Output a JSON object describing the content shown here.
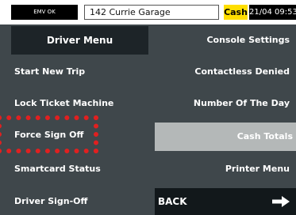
{
  "status_bar": {
    "emv_status": "EMV OK",
    "location": "142 Currie Garage",
    "payment_mode": "Cash",
    "datetime": "21/04 09:53"
  },
  "menu": {
    "title": "Driver Menu",
    "left_items": [
      "Start New Trip",
      "Lock Ticket Machine",
      "Force Sign Off",
      "Smartcard Status",
      "Driver Sign-Off"
    ],
    "right_items": [
      "Console Settings",
      "Contactless Denied",
      "Number Of The Day",
      "Cash Totals",
      "Printer Menu"
    ],
    "back_label": "BACK",
    "back_icon": "arrow-right-icon"
  },
  "colors": {
    "background": "#3f474b",
    "cash_badge": "#ffde00",
    "selected_item": "#b4b8b8",
    "highlight": "#e02020"
  }
}
